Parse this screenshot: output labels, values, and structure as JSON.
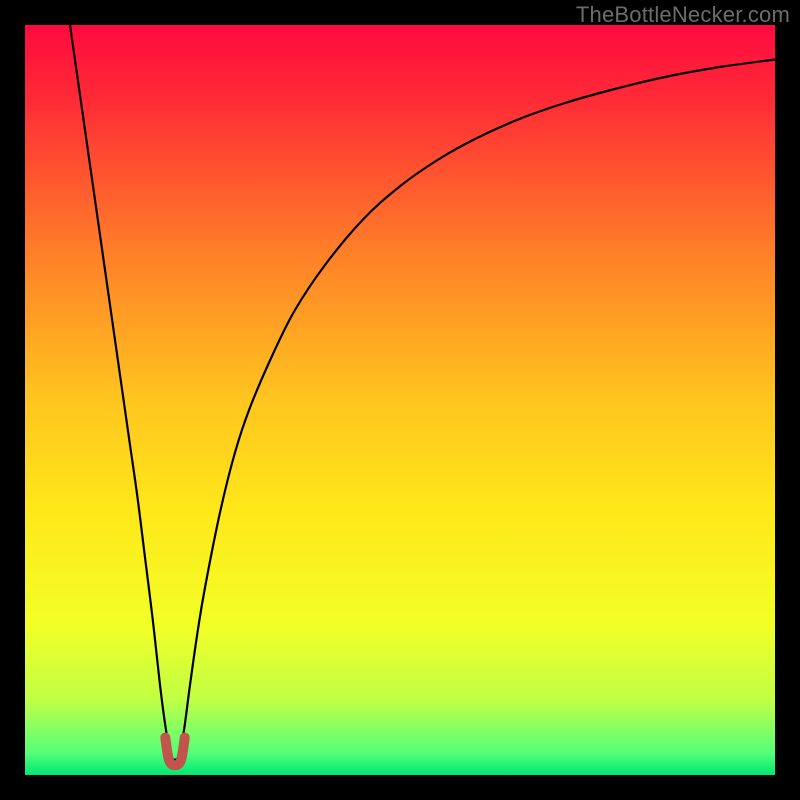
{
  "watermark": "TheBottleNecker.com",
  "chart_data": {
    "type": "line",
    "title": "",
    "xlabel": "",
    "ylabel": "",
    "xlim": [
      0,
      100
    ],
    "ylim": [
      0,
      100
    ],
    "grid": false,
    "legend": false,
    "background_gradient": {
      "stops": [
        {
          "offset": 0.0,
          "color": "#ff0a3f"
        },
        {
          "offset": 0.1,
          "color": "#ff2b36"
        },
        {
          "offset": 0.3,
          "color": "#ff7e29"
        },
        {
          "offset": 0.5,
          "color": "#ffc51f"
        },
        {
          "offset": 0.65,
          "color": "#ffe81a"
        },
        {
          "offset": 0.8,
          "color": "#f2ff27"
        },
        {
          "offset": 0.9,
          "color": "#c0ff44"
        },
        {
          "offset": 0.97,
          "color": "#55ff79"
        },
        {
          "offset": 1.0,
          "color": "#00e874"
        }
      ]
    },
    "series": [
      {
        "name": "bottleneck-curve",
        "stroke": "#000000",
        "stroke_width": 2.2,
        "x": [
          6,
          7,
          8,
          9,
          10,
          11,
          12,
          13,
          14,
          15,
          16,
          17,
          18,
          18.8,
          19.5,
          20.5,
          21.2,
          22,
          23,
          24,
          26,
          28,
          30,
          33,
          36,
          40,
          45,
          50,
          55,
          60,
          66,
          72,
          78,
          85,
          92,
          100
        ],
        "y": [
          100,
          93,
          86,
          79,
          72,
          65,
          58,
          51,
          44,
          37,
          29,
          21,
          12,
          6,
          2.5,
          2.5,
          6,
          12,
          19,
          25,
          35,
          43,
          49,
          56,
          62,
          68,
          74,
          78.5,
          82,
          84.8,
          87.5,
          89.6,
          91.3,
          93,
          94.3,
          95.4
        ]
      },
      {
        "name": "optimal-marker",
        "stroke": "#c1544c",
        "stroke_width": 10,
        "shape": "u",
        "x": [
          18.7,
          19.2,
          20.0,
          20.8,
          21.3
        ],
        "y": [
          5.0,
          2.0,
          1.3,
          2.0,
          5.0
        ]
      }
    ]
  }
}
